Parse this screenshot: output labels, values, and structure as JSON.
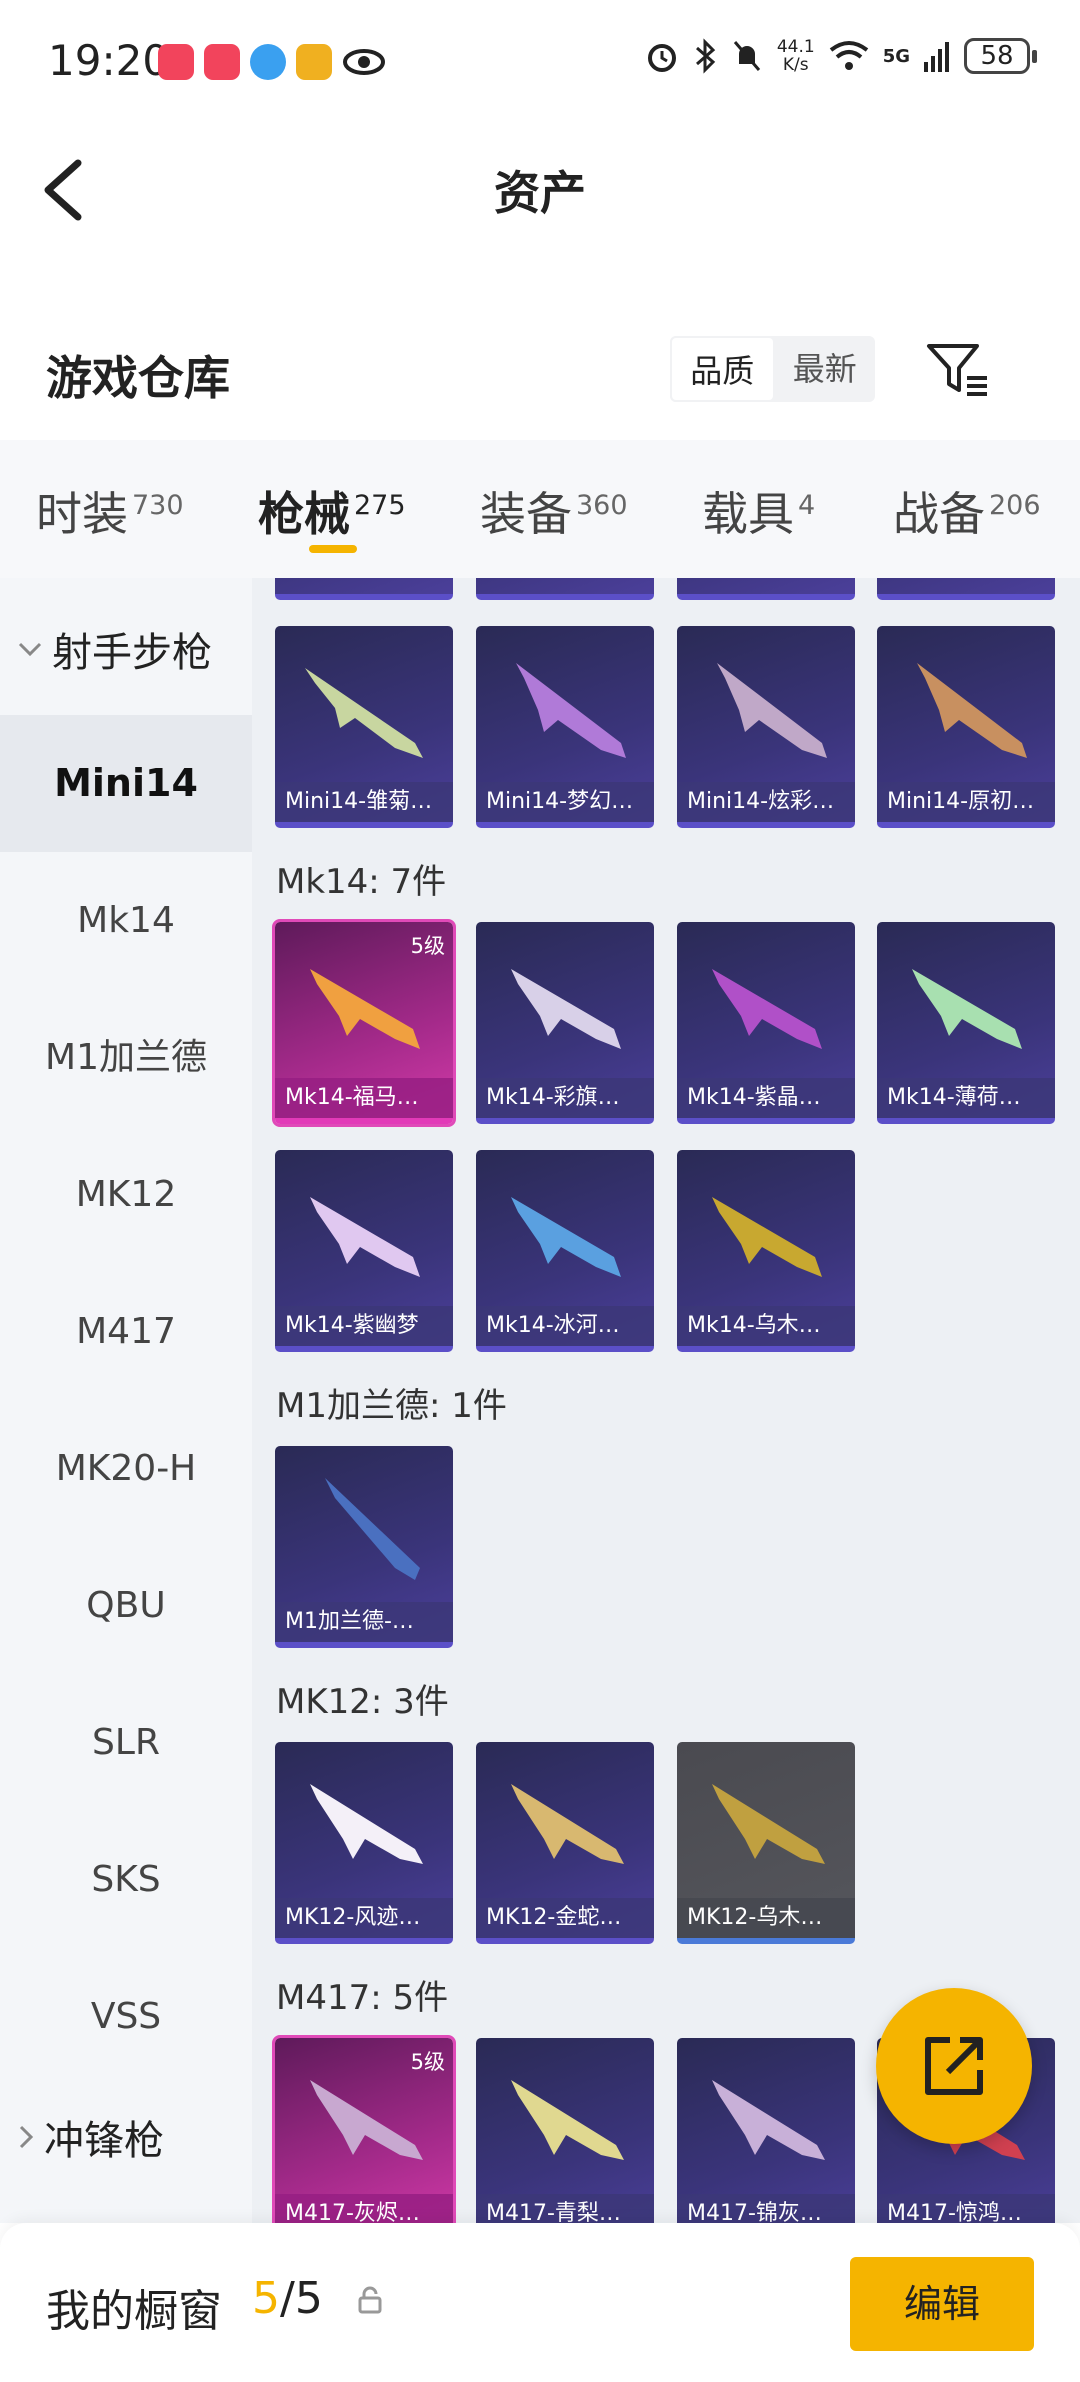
{
  "status_bar": {
    "time": "19:20",
    "net_speed_value": "44.1",
    "net_speed_unit": "K/s",
    "network": "5G",
    "battery": "58"
  },
  "nav": {
    "title": "资产"
  },
  "header": {
    "title": "游戏仓库",
    "sort_options": [
      "品质",
      "最新"
    ]
  },
  "tabs": [
    {
      "label": "时装",
      "count": "730"
    },
    {
      "label": "枪械",
      "count": "275"
    },
    {
      "label": "装备",
      "count": "360"
    },
    {
      "label": "载具",
      "count": "4"
    },
    {
      "label": "战备",
      "count": "206"
    }
  ],
  "sidebar": {
    "group_expanded": "射手步枪",
    "items": [
      "Mini14",
      "Mk14",
      "M1加兰德",
      "MK12",
      "M417",
      "MK20-H",
      "QBU",
      "SLR",
      "SKS",
      "VSS"
    ],
    "group_collapsed": "冲锋枪"
  },
  "sections": {
    "mk14": "Mk14: 7件",
    "m1": "M1加兰德: 1件",
    "mk12": "MK12: 3件",
    "m417": "M417: 5件"
  },
  "cards": {
    "mini14": [
      "Mini14-雏菊…",
      "Mini14-梦幻…",
      "Mini14-炫彩…",
      "Mini14-原初…"
    ],
    "mk14": [
      "Mk14-福马…",
      "Mk14-彩旗…",
      "Mk14-紫晶…",
      "Mk14-薄荷…",
      "Mk14-紫幽梦",
      "Mk14-冰河…",
      "Mk14-乌木…"
    ],
    "m1": [
      "M1加兰德-…"
    ],
    "mk12": [
      "MK12-风迹…",
      "MK12-金蛇…",
      "MK12-乌木…"
    ],
    "m417": [
      "M417-灰烬…",
      "M417-青梨…",
      "M417-锦灰…",
      "M417-惊鸿…"
    ],
    "level_label": "5级"
  },
  "bottom": {
    "title": "我的橱窗",
    "current": "5",
    "separator": "/",
    "total": "5",
    "edit_label": "编辑"
  },
  "colors": {
    "accent": "#f5b400",
    "card_purple": "#3a347a",
    "card_pink": "#d23aa8"
  }
}
